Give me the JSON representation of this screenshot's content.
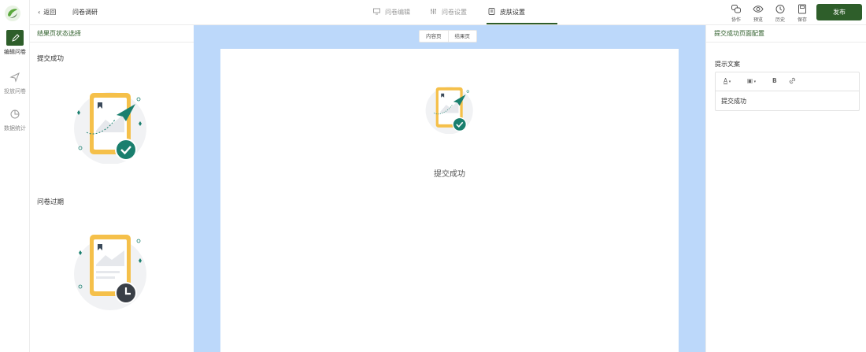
{
  "rail": {
    "items": [
      {
        "label": "编辑问卷",
        "icon": "edit-icon"
      },
      {
        "label": "投放问卷",
        "icon": "send-icon"
      },
      {
        "label": "数据统计",
        "icon": "pie-chart-icon"
      }
    ]
  },
  "topbar": {
    "back_label": "返回",
    "title": "问卷调研",
    "tabs": [
      {
        "label": "问卷编辑",
        "icon": "monitor-icon"
      },
      {
        "label": "问卷设置",
        "icon": "sliders-icon"
      },
      {
        "label": "皮肤设置",
        "icon": "skin-icon"
      }
    ],
    "tools": [
      {
        "label": "协作",
        "icon": "collaborate-icon"
      },
      {
        "label": "预览",
        "icon": "eye-icon"
      },
      {
        "label": "历史",
        "icon": "history-icon"
      },
      {
        "label": "保存",
        "icon": "save-icon"
      }
    ],
    "publish_label": "发布"
  },
  "left": {
    "header": "结果页状态选择",
    "states": [
      {
        "title": "提交成功",
        "icon": "submit-success-illustration"
      },
      {
        "title": "问卷过期",
        "icon": "survey-expired-illustration"
      }
    ]
  },
  "center": {
    "segments": [
      "内容页",
      "结果页"
    ],
    "page_text": "提交成功"
  },
  "right": {
    "header": "提交成功页面配置",
    "field_label": "提示文案",
    "editor_tools": [
      "A",
      "▣",
      "B",
      "link"
    ],
    "editor_text": "提交成功"
  },
  "colors": {
    "brand": "#2e5e2a",
    "canvas_bg": "#bcd8fa",
    "teal": "#1a7f6e",
    "yellow": "#f5c04a"
  }
}
